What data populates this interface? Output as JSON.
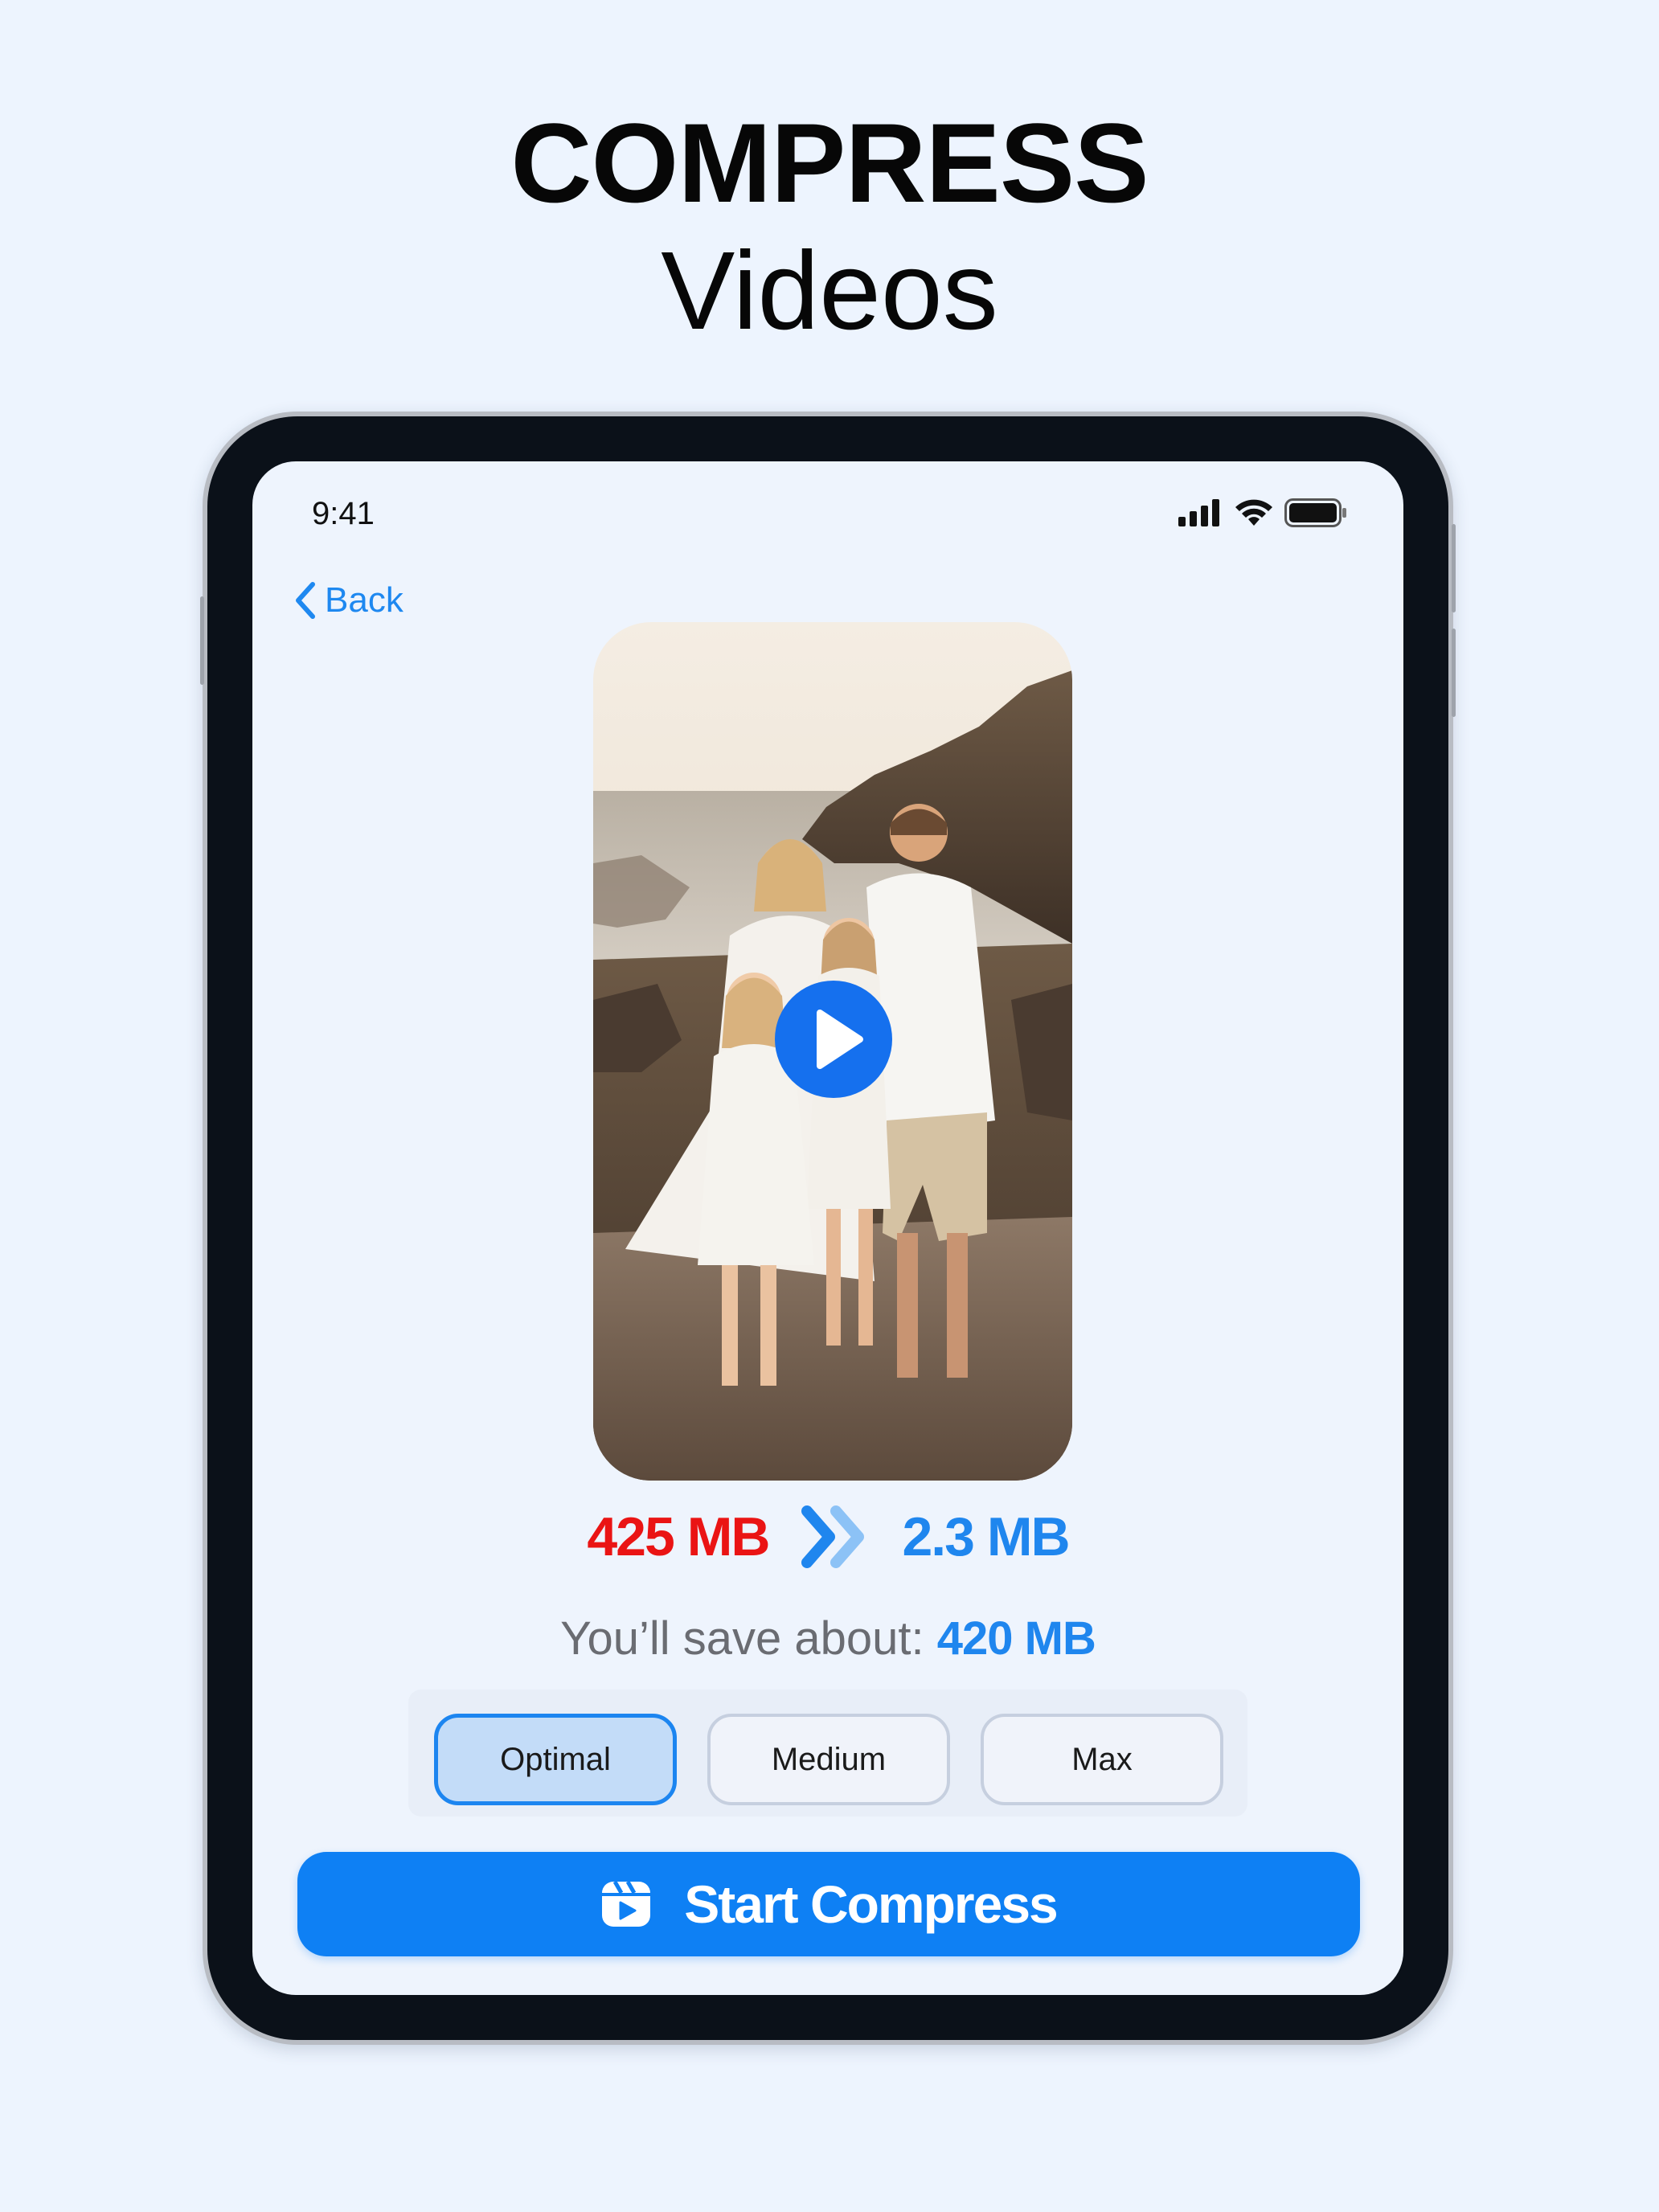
{
  "headline": {
    "line1": "COMPRESS",
    "line2": "Videos"
  },
  "status_bar": {
    "time": "9:41",
    "icons": [
      "signal-icon",
      "wifi-icon",
      "battery-icon"
    ]
  },
  "nav": {
    "back_label": "Back"
  },
  "video": {
    "play_icon": "play-icon",
    "thumbnail": "family-beach-photo"
  },
  "compression": {
    "original_size": "425 MB",
    "compressed_size": "2.3 MB",
    "arrow_icon": "double-chevron-right-icon",
    "save_label": "You’ll save about:",
    "save_value": "420 MB"
  },
  "options": [
    {
      "label": "Optimal",
      "selected": true
    },
    {
      "label": "Medium",
      "selected": false
    },
    {
      "label": "Max",
      "selected": false
    }
  ],
  "start_button": {
    "label": "Start Compress",
    "icon": "video-clapper-icon"
  },
  "colors": {
    "background": "#edf4fe",
    "accent": "#0e80f4",
    "original_size": "#ea1414",
    "compressed_size": "#1f86ee"
  }
}
